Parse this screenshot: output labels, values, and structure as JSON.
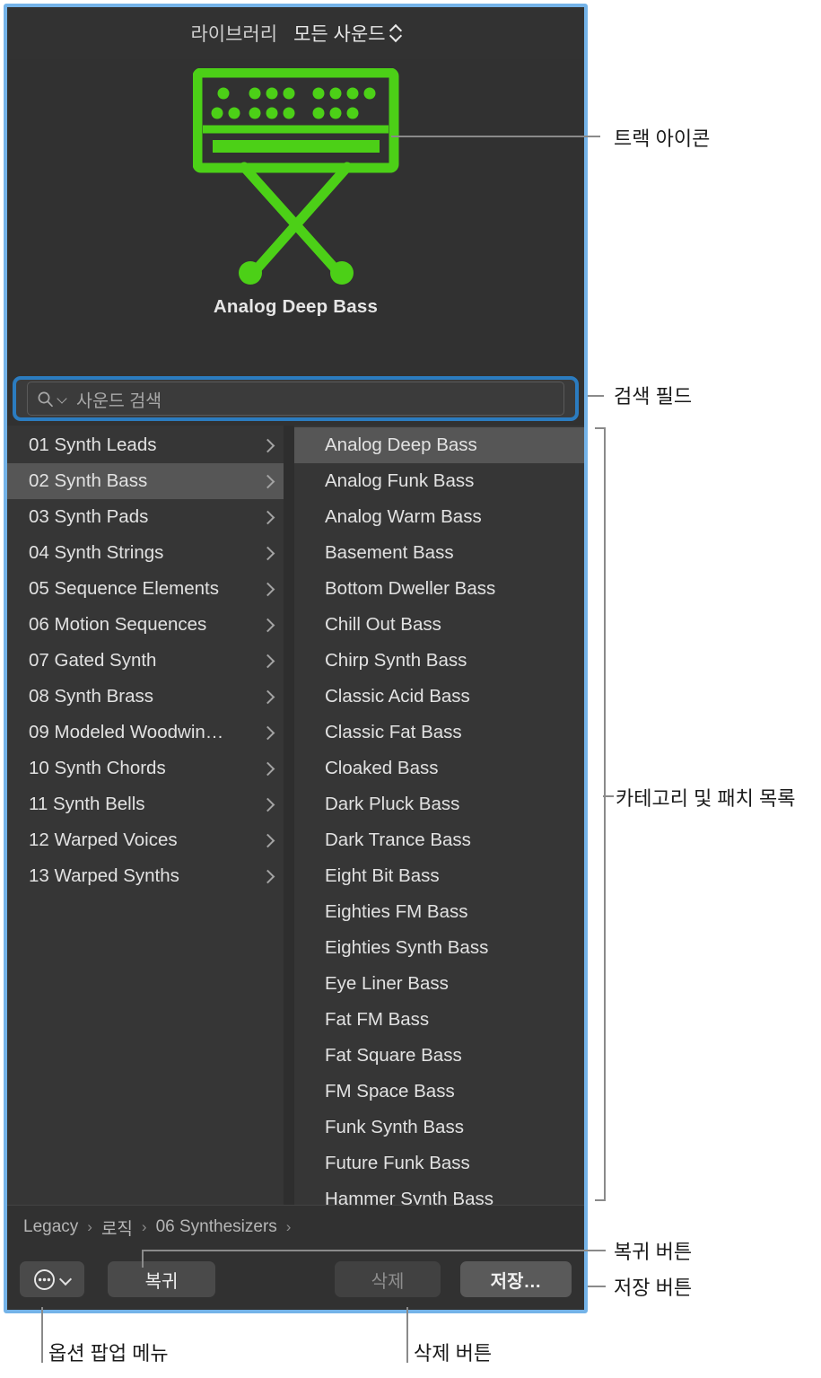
{
  "header": {
    "library_label": "라이브러리",
    "all_sounds_label": "모든 사운드",
    "chevron_icon": "up-down-chevron-icon"
  },
  "icon_area": {
    "track_icon": "synthesizer-keyboard-icon",
    "track_icon_color": "#4cd017",
    "patch_name": "Analog Deep Bass"
  },
  "search": {
    "placeholder": "사운드 검색",
    "value": "",
    "magnifier_icon": "search-icon",
    "chevron_icon": "chevron-down-icon",
    "focus_ring_color": "#2b7cc0"
  },
  "browser": {
    "categories": [
      {
        "label": "01 Synth Leads",
        "selected": false
      },
      {
        "label": "02 Synth Bass",
        "selected": true
      },
      {
        "label": "03 Synth Pads",
        "selected": false
      },
      {
        "label": "04 Synth Strings",
        "selected": false
      },
      {
        "label": "05 Sequence Elements",
        "selected": false
      },
      {
        "label": "06 Motion Sequences",
        "selected": false
      },
      {
        "label": "07 Gated Synth",
        "selected": false
      },
      {
        "label": "08 Synth Brass",
        "selected": false
      },
      {
        "label": "09 Modeled Woodwin…",
        "selected": false
      },
      {
        "label": "10 Synth Chords",
        "selected": false
      },
      {
        "label": "11 Synth Bells",
        "selected": false
      },
      {
        "label": "12 Warped Voices",
        "selected": false
      },
      {
        "label": "13 Warped Synths",
        "selected": false
      }
    ],
    "patches": [
      {
        "label": "Analog Deep Bass",
        "selected": true
      },
      {
        "label": "Analog Funk Bass",
        "selected": false
      },
      {
        "label": "Analog Warm Bass",
        "selected": false
      },
      {
        "label": "Basement Bass",
        "selected": false
      },
      {
        "label": "Bottom Dweller Bass",
        "selected": false
      },
      {
        "label": "Chill Out Bass",
        "selected": false
      },
      {
        "label": "Chirp Synth Bass",
        "selected": false
      },
      {
        "label": "Classic Acid Bass",
        "selected": false
      },
      {
        "label": "Classic Fat Bass",
        "selected": false
      },
      {
        "label": "Cloaked Bass",
        "selected": false
      },
      {
        "label": "Dark Pluck Bass",
        "selected": false
      },
      {
        "label": "Dark Trance Bass",
        "selected": false
      },
      {
        "label": "Eight Bit Bass",
        "selected": false
      },
      {
        "label": "Eighties FM Bass",
        "selected": false
      },
      {
        "label": "Eighties Synth Bass",
        "selected": false
      },
      {
        "label": "Eye Liner Bass",
        "selected": false
      },
      {
        "label": "Fat FM Bass",
        "selected": false
      },
      {
        "label": "Fat Square Bass",
        "selected": false
      },
      {
        "label": "FM Space Bass",
        "selected": false
      },
      {
        "label": "Funk Synth Bass",
        "selected": false
      },
      {
        "label": "Future Funk Bass",
        "selected": false
      },
      {
        "label": "Hammer Synth Bass",
        "selected": false
      }
    ]
  },
  "breadcrumb": {
    "separator": "›",
    "items": [
      "Legacy",
      "로직",
      "06 Synthesizers"
    ]
  },
  "actions": {
    "options_icon": "ellipsis-circle-icon",
    "options_chevron_icon": "chevron-down-icon",
    "revert_label": "복귀",
    "delete_label": "삭제",
    "save_label": "저장…"
  },
  "annotations": {
    "track_icon": "트랙 아이콘",
    "search_field": "검색 필드",
    "category_patch_list": "카테고리 및 패치 목록",
    "revert_button": "복귀 버튼",
    "save_button": "저장 버튼",
    "options_popup_menu": "옵션 팝업 메뉴",
    "delete_button": "삭제 버튼"
  }
}
